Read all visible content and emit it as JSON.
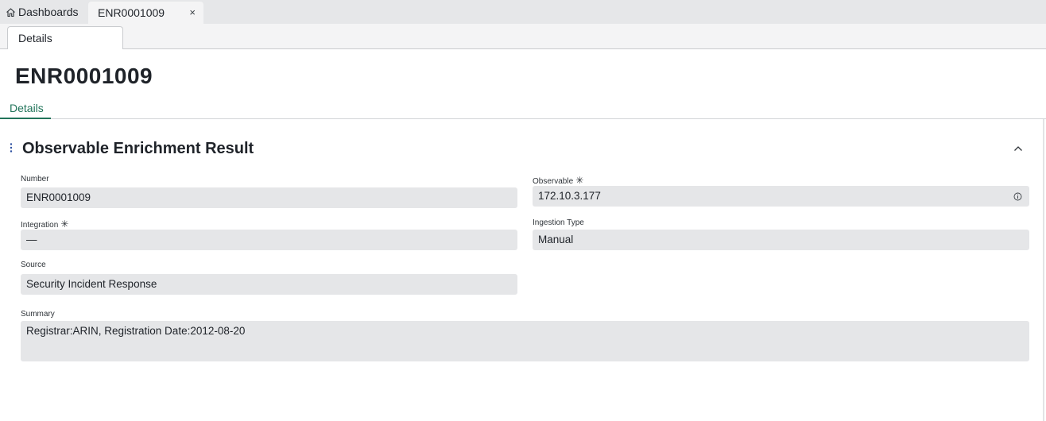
{
  "tabs": {
    "dashboards_label": "Dashboards",
    "record_label": "ENR0001009",
    "close_glyph": "×"
  },
  "subtab": {
    "label": "Details"
  },
  "record": {
    "title": "ENR0001009"
  },
  "details_tab": {
    "label": "Details"
  },
  "section": {
    "title": "Observable Enrichment Result",
    "menu_glyph": "⋮"
  },
  "fields": {
    "number": {
      "label": "Number",
      "value": "ENR0001009"
    },
    "observable": {
      "label": "Observable",
      "required": "✳",
      "value": "172.10.3.177"
    },
    "integration": {
      "label": "Integration",
      "required": "✳",
      "value": "—"
    },
    "ingestion_type": {
      "label": "Ingestion Type",
      "value": "Manual"
    },
    "source": {
      "label": "Source",
      "value": "Security Incident Response"
    },
    "summary": {
      "label": "Summary",
      "value": "Registrar:ARIN, Registration Date:2012-08-20"
    }
  },
  "colors": {
    "accent": "#21745a",
    "field_bg": "#e5e6e8",
    "tab_strip": "#e6e7e9"
  }
}
